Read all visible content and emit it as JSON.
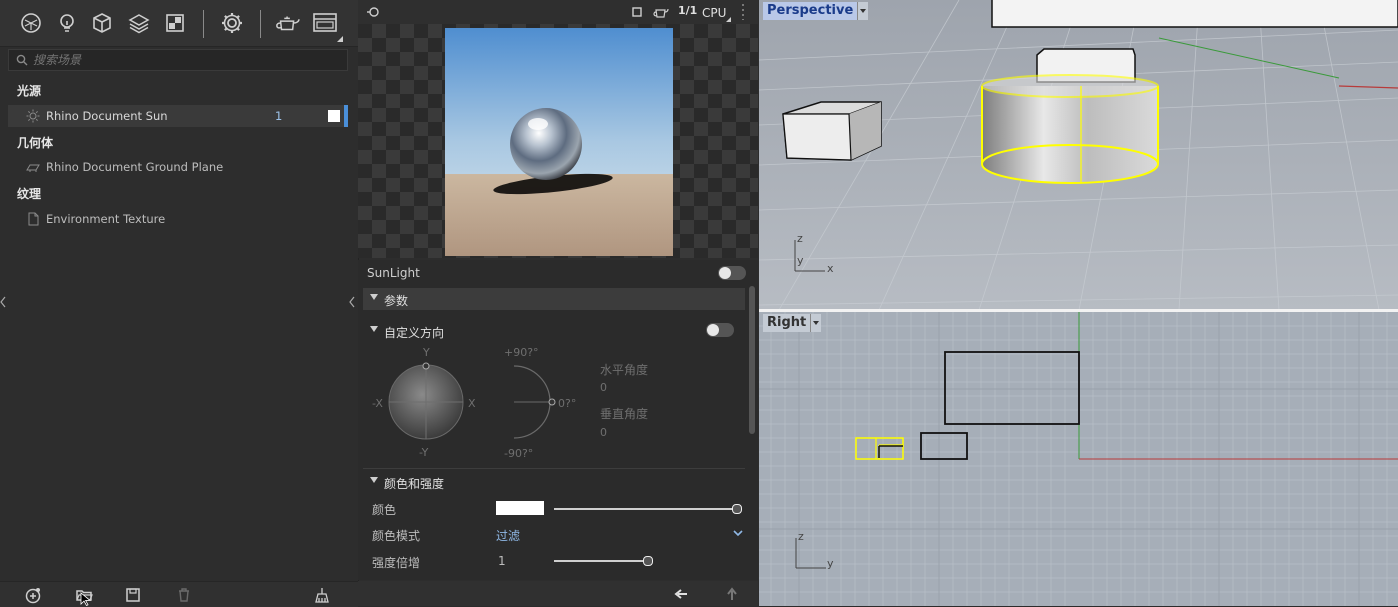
{
  "left_panel": {
    "search_placeholder": "搜索场景",
    "sections": [
      {
        "title": "光源",
        "items": [
          {
            "label": "Rhino Document Sun",
            "count": "1",
            "icon": "sun-icon"
          }
        ]
      },
      {
        "title": "几何体",
        "items": [
          {
            "label": "Rhino Document Ground Plane",
            "icon": "ground-plane-icon"
          }
        ]
      },
      {
        "title": "纹理",
        "items": [
          {
            "label": "Environment Texture",
            "icon": "document-icon"
          }
        ]
      }
    ]
  },
  "preview": {
    "mode_label": "CPU",
    "pass_label": "1/1"
  },
  "properties": {
    "sunlight_label": "SunLight",
    "params_group": "参数",
    "custom_direction_group": "自定义方向",
    "compass": {
      "top": "Y",
      "bottom": "-Y",
      "left": "-X",
      "right": "X"
    },
    "elevation": {
      "top": "+90?°",
      "right": "0?°",
      "bottom": "-90?°"
    },
    "horizontal_angle_label": "水平角度",
    "horizontal_angle_value": "0",
    "vertical_angle_label": "垂直角度",
    "vertical_angle_value": "0",
    "color_group": "颜色和强度",
    "color_label": "颜色",
    "color_value": "#ffffff",
    "color_mode_label": "颜色模式",
    "color_mode_value": "过滤",
    "intensity_label": "强度倍增",
    "intensity_value": "1"
  },
  "viewports": {
    "perspective": {
      "name": "Perspective",
      "axis_z": "z",
      "axis_y": "y",
      "axis_x": "x"
    },
    "right": {
      "name": "Right",
      "axis_z": "z",
      "axis_y": "y"
    }
  },
  "colors": {
    "accent": "#4a8fd9",
    "selection": "#ffff00"
  }
}
